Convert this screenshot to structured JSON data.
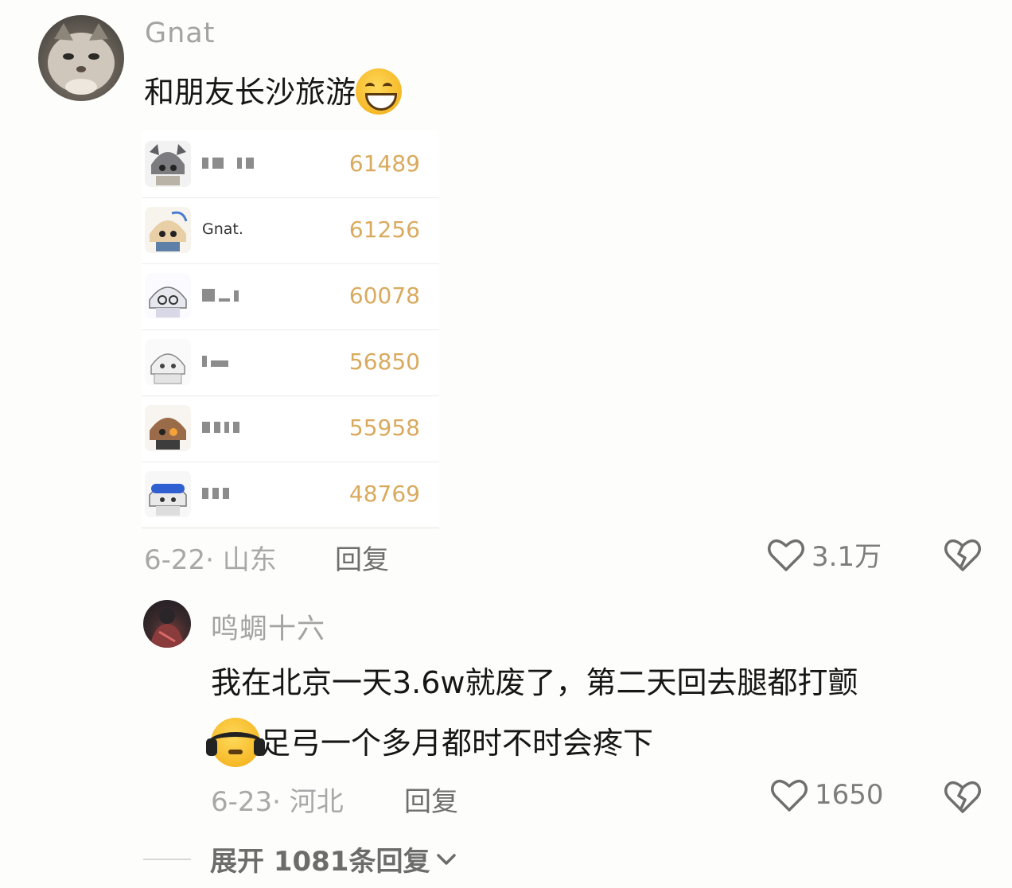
{
  "comment": {
    "username": "Gnat",
    "text": "和朋友长沙旅游",
    "emoji": "grinning-face",
    "date": "6-22",
    "location": "· 山东",
    "reply_label": "回复",
    "likes": "3.1万",
    "leaderboard": [
      {
        "name": "",
        "score": "61489"
      },
      {
        "name": "Gnat.",
        "score": "61256"
      },
      {
        "name": "",
        "score": "60078"
      },
      {
        "name": "",
        "score": "56850"
      },
      {
        "name": "",
        "score": "55958"
      },
      {
        "name": "",
        "score": "48769"
      }
    ]
  },
  "reply": {
    "username": "鸣蜩十六",
    "text_line1": "我在北京一天3.6w就废了，第二天回去腿都打颤",
    "text_line2": "足弓一个多月都时不时会疼下",
    "emoji": "headphones-sad-face",
    "date": "6-23",
    "location": "· 河北",
    "reply_label": "回复",
    "likes": "1650"
  },
  "expand": {
    "label": "展开 1081条回复"
  },
  "colors": {
    "score": "#d9aa5e",
    "meta": "#a8a8a8",
    "text": "#161616"
  }
}
